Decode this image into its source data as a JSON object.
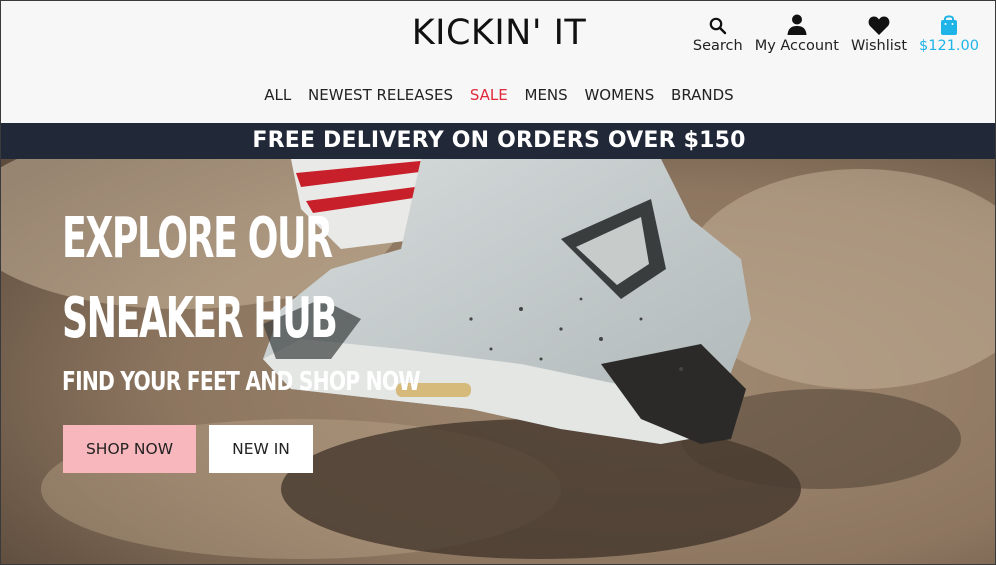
{
  "header": {
    "logo": "KICKIN' IT",
    "icons": [
      {
        "icon": "search-icon",
        "label": "Search"
      },
      {
        "icon": "account-icon",
        "label": "My Account"
      },
      {
        "icon": "heart-icon",
        "label": "Wishlist"
      },
      {
        "icon": "bag-icon",
        "label": "$121.00"
      }
    ]
  },
  "nav": {
    "items": [
      "ALL",
      "NEWEST RELEASES",
      "SALE",
      "MENS",
      "WOMENS",
      "BRANDS"
    ]
  },
  "banner": {
    "text": "FREE DELIVERY ON ORDERS OVER $150"
  },
  "hero": {
    "title_line1": "EXPLORE OUR",
    "title_line2": "SNEAKER HUB",
    "subtitle": "FIND YOUR FEET AND SHOP NOW",
    "shop_button": "SHOP NOW",
    "newin_button": "NEW IN"
  },
  "colors": {
    "sale": "#e02a3a",
    "cart_total": "#1fb4e8",
    "banner_bg": "#212838",
    "shop_button_bg": "#f8b7bc"
  }
}
